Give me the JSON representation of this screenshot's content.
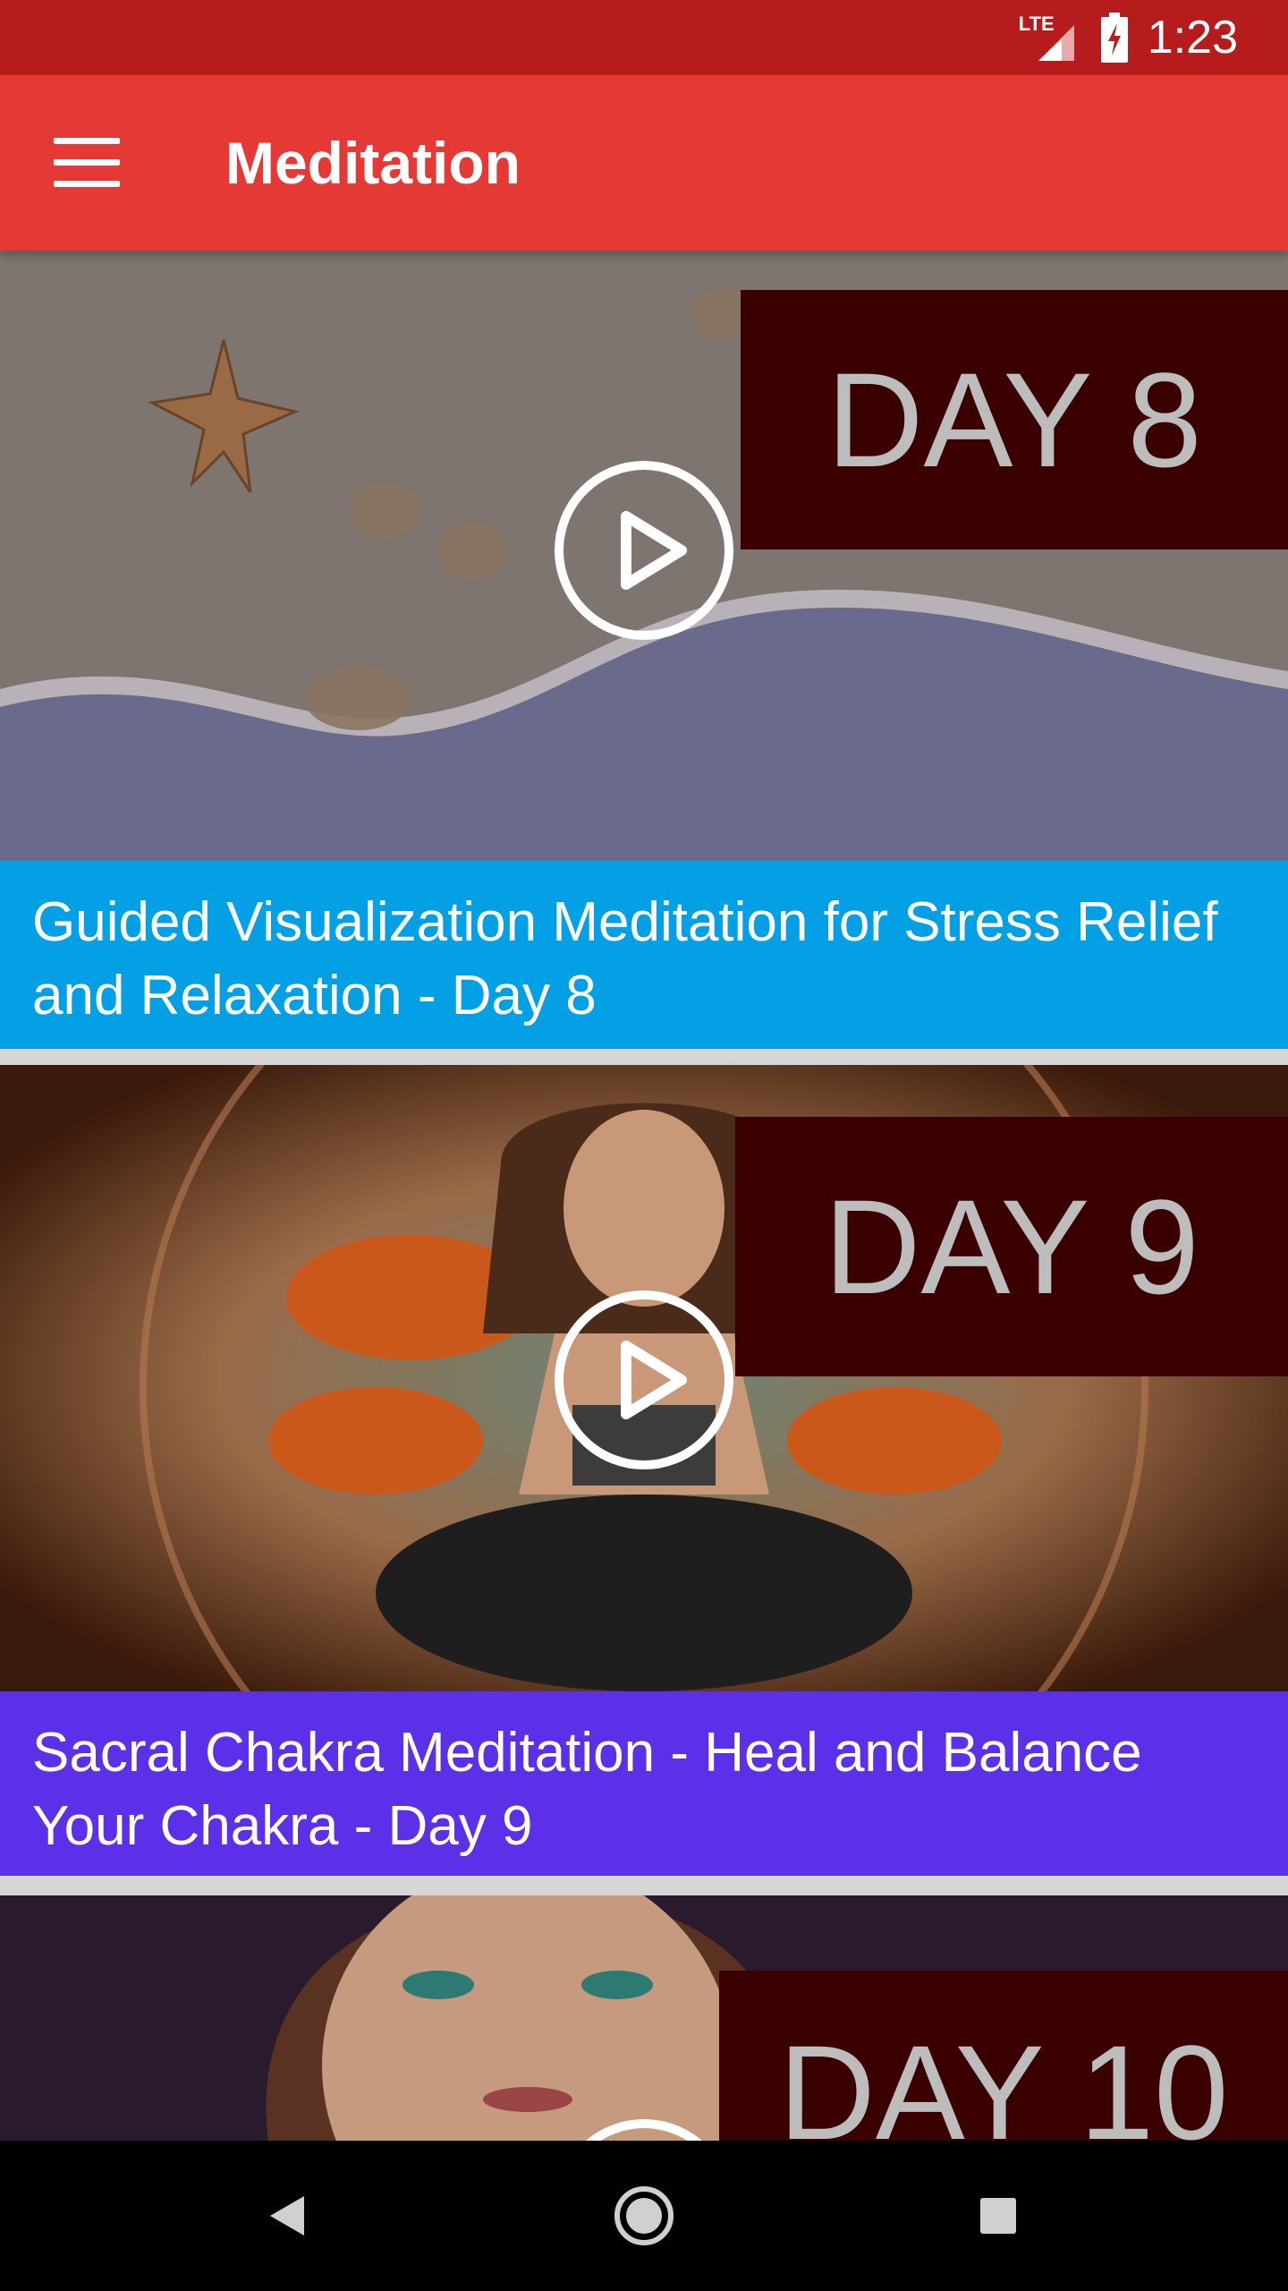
{
  "status_bar": {
    "time": "1:23",
    "network_label": "LTE",
    "icons": [
      "lte-signal-icon",
      "battery-charging-icon"
    ]
  },
  "app_bar": {
    "title": "Meditation",
    "menu_icon": "hamburger-menu-icon",
    "color": "#e53935"
  },
  "videos": [
    {
      "title": "Guided Visualization Meditation for Stress Relief and Relaxation - Day 8",
      "day_label": "DAY 8",
      "caption_color": "#03a0e6"
    },
    {
      "title": "Sacral Chakra Meditation - Heal and Balance Your Chakra - Day 9",
      "day_label": "DAY 9",
      "caption_color": "#5c2fe8"
    },
    {
      "title": "",
      "day_label": "DAY 10",
      "caption_color": ""
    }
  ],
  "nav_bar": {
    "icons": [
      "back-icon",
      "home-icon",
      "recents-icon"
    ]
  }
}
